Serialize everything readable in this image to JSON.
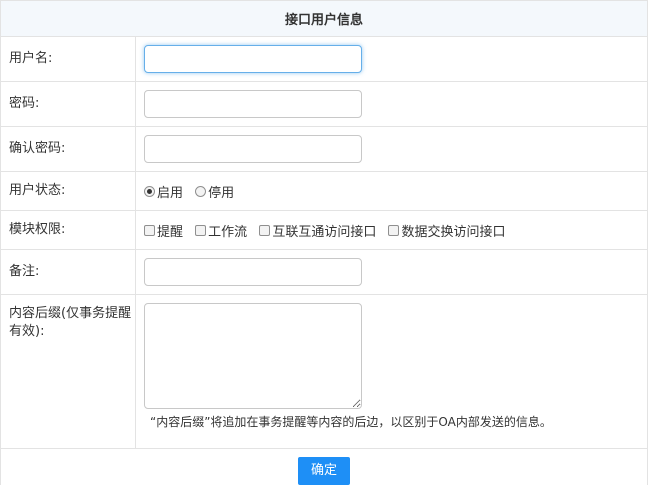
{
  "form": {
    "title": "接口用户信息",
    "username": {
      "label": "用户名:",
      "value": ""
    },
    "password": {
      "label": "密码:",
      "value": ""
    },
    "confirm_password": {
      "label": "确认密码:",
      "value": ""
    },
    "status": {
      "label": "用户状态:",
      "options": [
        {
          "label": "启用",
          "checked": true
        },
        {
          "label": "停用",
          "checked": false
        }
      ]
    },
    "modules": {
      "label": "模块权限:",
      "options": [
        {
          "label": "提醒",
          "checked": false
        },
        {
          "label": "工作流",
          "checked": false
        },
        {
          "label": "互联互通访问接口",
          "checked": false
        },
        {
          "label": "数据交换访问接口",
          "checked": false
        }
      ]
    },
    "note": {
      "label": "备注:",
      "value": ""
    },
    "content_suffix": {
      "label": "内容后缀(仅事务提醒有效):",
      "value": "",
      "hint": "“内容后缀”将追加在事务提醒等内容的后边，以区别于OA内部发送的信息。"
    },
    "confirm_button": "确定"
  },
  "colors": {
    "accent": "#1e8ff6",
    "header_bg": "#f4f8fc",
    "border": "#e3e3e3",
    "focus": "#66afe9"
  }
}
